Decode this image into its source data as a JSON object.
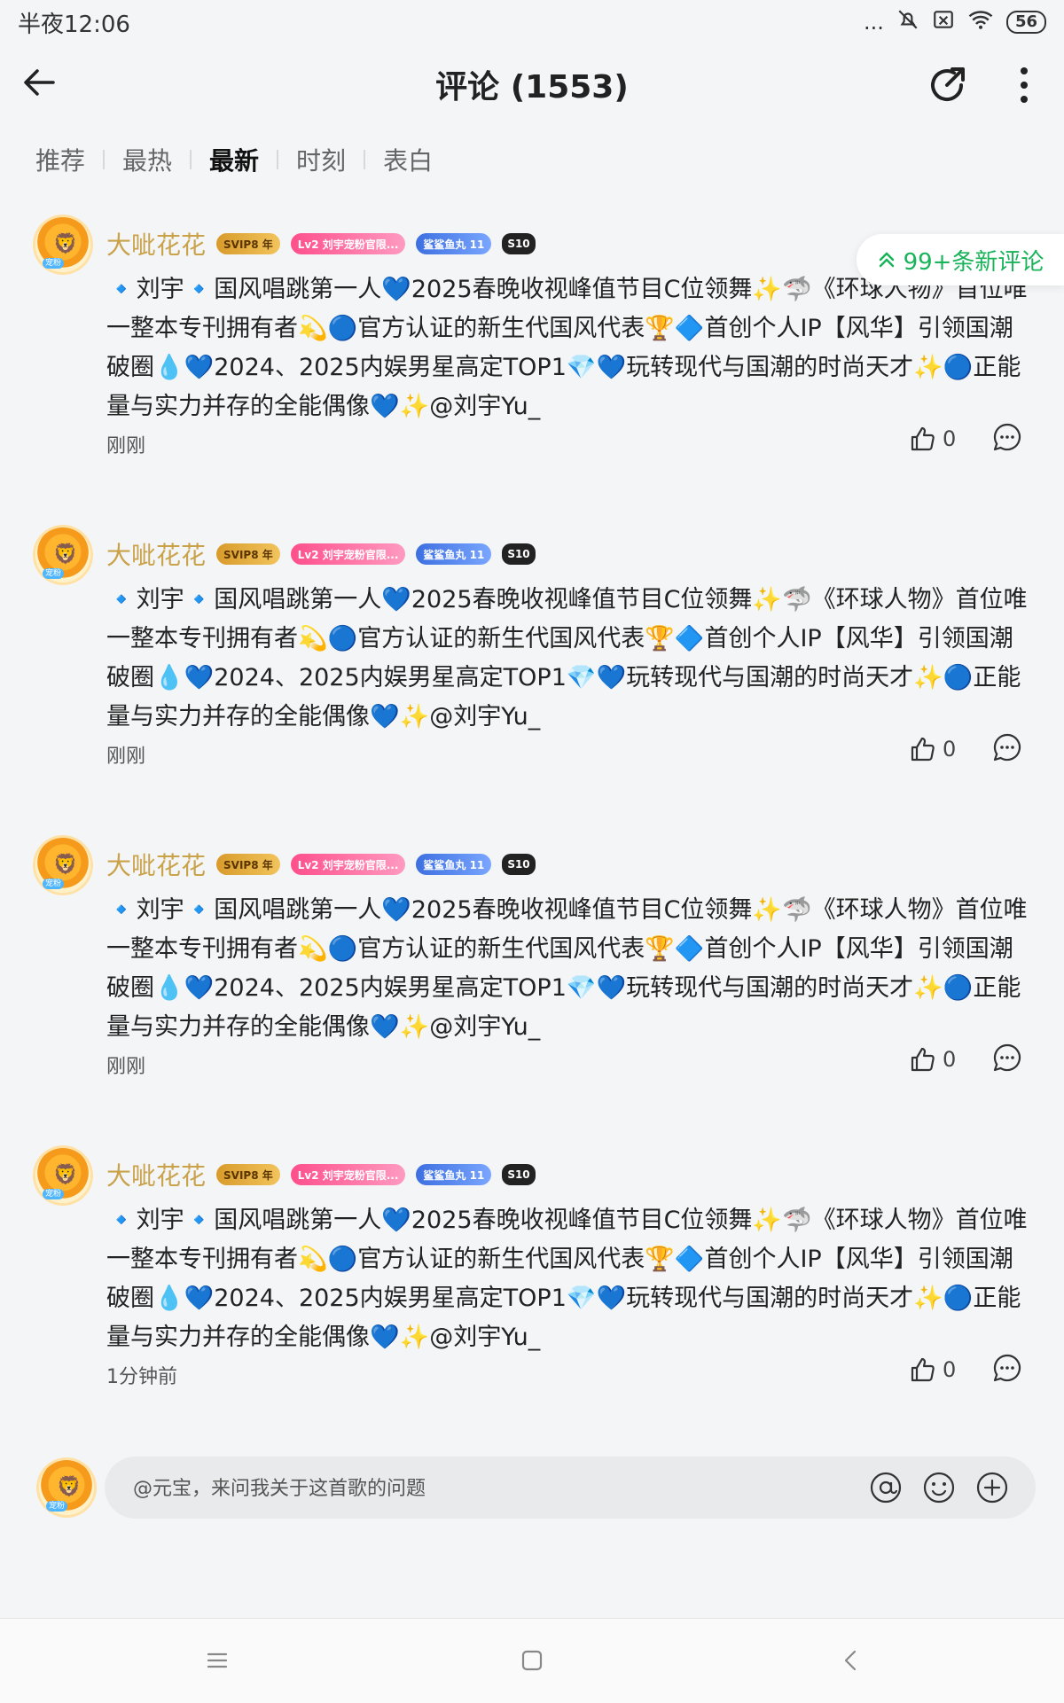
{
  "status_bar": {
    "time": "半夜12:06",
    "dots": "...",
    "battery": "56"
  },
  "header": {
    "title": "评论 (1553)"
  },
  "tabs": [
    {
      "label": "推荐",
      "active": false
    },
    {
      "label": "最热",
      "active": false
    },
    {
      "label": "最新",
      "active": true
    },
    {
      "label": "时刻",
      "active": false
    },
    {
      "label": "表白",
      "active": false
    }
  ],
  "new_comments_pill": {
    "label": "99+条新评论",
    "color": "#19b35a"
  },
  "comments": [
    {
      "username": "大呲花花",
      "badges": [
        "SVIP8 年",
        "Lv2 刘宇宠粉官限...",
        "鲨鲨鱼丸 11",
        "S10"
      ],
      "avatar_tag": "宠粉",
      "text": "🔹刘宇🔹国风唱跳第一人💙2025春晚收视峰值节目C位领舞✨🦈《环球人物》首位唯一整本专刊拥有者💫🔵官方认证的新生代国风代表🏆🔷首创个人IP【风华】引领国潮破圈💧💙2024、2025内娱男星高定TOP1💎💙玩转现代与国潮的时尚天才✨🔵正能量与实力并存的全能偶像💙✨@刘宇Yu_",
      "time": "刚刚",
      "likes": "0"
    },
    {
      "username": "大呲花花",
      "badges": [
        "SVIP8 年",
        "Lv2 刘宇宠粉官限...",
        "鲨鲨鱼丸 11",
        "S10"
      ],
      "avatar_tag": "宠粉",
      "text": "🔹刘宇🔹国风唱跳第一人💙2025春晚收视峰值节目C位领舞✨🦈《环球人物》首位唯一整本专刊拥有者💫🔵官方认证的新生代国风代表🏆🔷首创个人IP【风华】引领国潮破圈💧💙2024、2025内娱男星高定TOP1💎💙玩转现代与国潮的时尚天才✨🔵正能量与实力并存的全能偶像💙✨@刘宇Yu_",
      "time": "刚刚",
      "likes": "0"
    },
    {
      "username": "大呲花花",
      "badges": [
        "SVIP8 年",
        "Lv2 刘宇宠粉官限...",
        "鲨鲨鱼丸 11",
        "S10"
      ],
      "avatar_tag": "宠粉",
      "text": "🔹刘宇🔹国风唱跳第一人💙2025春晚收视峰值节目C位领舞✨🦈《环球人物》首位唯一整本专刊拥有者💫🔵官方认证的新生代国风代表🏆🔷首创个人IP【风华】引领国潮破圈💧💙2024、2025内娱男星高定TOP1💎💙玩转现代与国潮的时尚天才✨🔵正能量与实力并存的全能偶像💙✨@刘宇Yu_",
      "time": "刚刚",
      "likes": "0"
    },
    {
      "username": "大呲花花",
      "badges": [
        "SVIP8 年",
        "Lv2 刘宇宠粉官限...",
        "鲨鲨鱼丸 11",
        "S10"
      ],
      "avatar_tag": "宠粉",
      "text": "🔹刘宇🔹国风唱跳第一人💙2025春晚收视峰值节目C位领舞✨🦈《环球人物》首位唯一整本专刊拥有者💫🔵官方认证的新生代国风代表🏆🔷首创个人IP【风华】引领国潮破圈💧💙2024、2025内娱男星高定TOP1💎💙玩转现代与国潮的时尚天才✨🔵正能量与实力并存的全能偶像💙✨@刘宇Yu_",
      "time": "1分钟前",
      "likes": "0"
    }
  ],
  "input": {
    "placeholder": "@元宝，来问我关于这首歌的问题",
    "avatar_tag": "宠粉"
  }
}
